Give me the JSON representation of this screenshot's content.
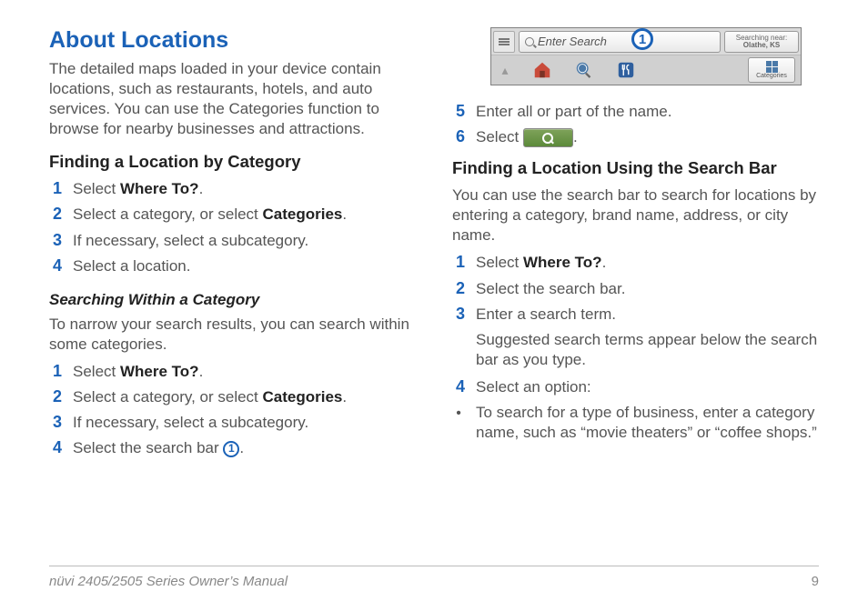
{
  "header": {
    "title": "About Locations"
  },
  "intro": "The detailed maps loaded in your device contain locations, such as restaurants, hotels, and auto services. You can use the Categories function to browse for nearby businesses and attractions.",
  "sectionA": {
    "title": "Finding a Location by Category",
    "steps": [
      {
        "n": "1",
        "pre": "Select ",
        "bold": "Where To?",
        "post": "."
      },
      {
        "n": "2",
        "pre": "Select a category, or select ",
        "bold": "Categories",
        "post": "."
      },
      {
        "n": "3",
        "pre": "If necessary, select a subcategory.",
        "bold": "",
        "post": ""
      },
      {
        "n": "4",
        "pre": "Select a location.",
        "bold": "",
        "post": ""
      }
    ]
  },
  "sectionB": {
    "title": "Searching Within a Category",
    "intro": "To narrow your search results, you can search within some categories.",
    "steps": [
      {
        "n": "1",
        "pre": "Select ",
        "bold": "Where To?",
        "post": "."
      },
      {
        "n": "2",
        "pre": "Select a category, or select ",
        "bold": "Categories",
        "post": "."
      },
      {
        "n": "3",
        "pre": "If necessary, select a subcategory.",
        "bold": "",
        "post": ""
      },
      {
        "n": "4",
        "pre": "Select the search bar ",
        "bold": "",
        "post": ".",
        "callout": "➀"
      }
    ]
  },
  "screenshot": {
    "search_placeholder": "Enter Search",
    "near_label_top": "Searching near:",
    "near_label_bottom": "Olathe, KS",
    "categories_label": "Categories",
    "callout_num": "1"
  },
  "step5": {
    "n": "5",
    "text": "Enter all or part of the name."
  },
  "step6": {
    "n": "6",
    "pre": "Select ",
    "post": "."
  },
  "sectionC": {
    "title": "Finding a Location Using the Search Bar",
    "intro": "You can use the search bar to search for locations by entering a category, brand name, address, or city name.",
    "steps": [
      {
        "n": "1",
        "pre": "Select ",
        "bold": "Where To?",
        "post": "."
      },
      {
        "n": "2",
        "pre": "Select the search bar.",
        "bold": "",
        "post": ""
      },
      {
        "n": "3",
        "pre": "Enter a search term.",
        "bold": "",
        "post": ""
      }
    ],
    "note": "Suggested search terms appear below the search bar as you type.",
    "step4": {
      "n": "4",
      "text": "Select an option:"
    },
    "bullet": "To search for a type of business, enter a category name, such as “movie theaters” or “coffee shops.”"
  },
  "footer": {
    "left": "nüvi 2405/2505 Series Owner’s Manual",
    "page": "9"
  }
}
